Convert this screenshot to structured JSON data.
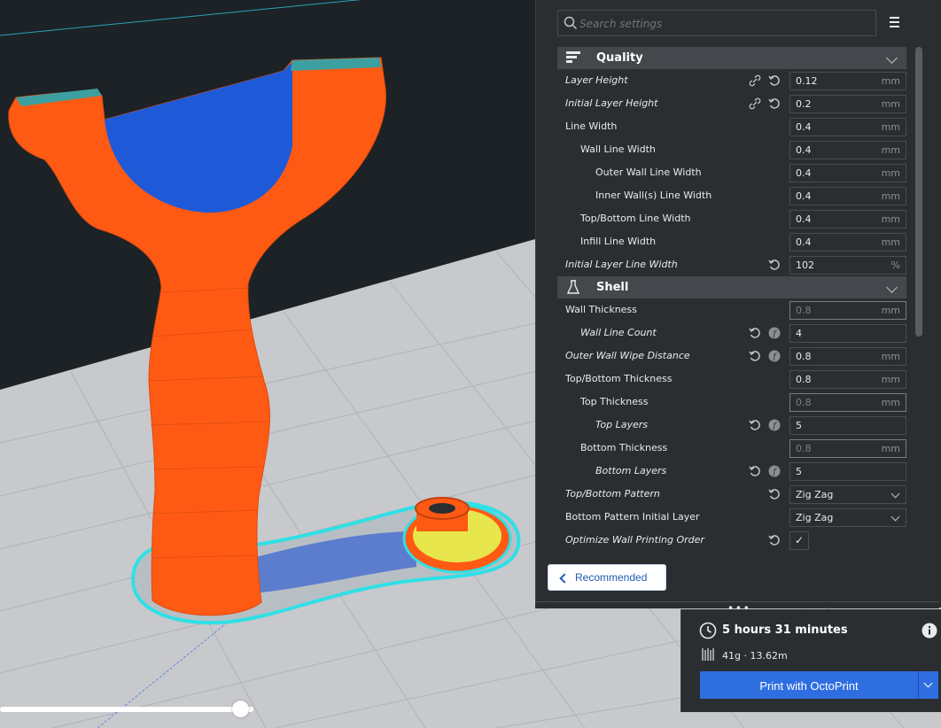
{
  "search": {
    "placeholder": "Search settings"
  },
  "categories": {
    "quality": "Quality",
    "shell": "Shell"
  },
  "quality_settings": [
    {
      "label": "Layer Height",
      "value": "0.12",
      "unit": "mm"
    },
    {
      "label": "Initial Layer Height",
      "value": "0.2",
      "unit": "mm"
    },
    {
      "label": "Line Width",
      "value": "0.4",
      "unit": "mm"
    },
    {
      "label": "Wall Line Width",
      "value": "0.4",
      "unit": "mm"
    },
    {
      "label": "Outer Wall Line Width",
      "value": "0.4",
      "unit": "mm"
    },
    {
      "label": "Inner Wall(s) Line Width",
      "value": "0.4",
      "unit": "mm"
    },
    {
      "label": "Top/Bottom Line Width",
      "value": "0.4",
      "unit": "mm"
    },
    {
      "label": "Infill Line Width",
      "value": "0.4",
      "unit": "mm"
    },
    {
      "label": "Initial Layer Line Width",
      "value": "102",
      "unit": "%"
    }
  ],
  "shell_settings": [
    {
      "label": "Wall Thickness",
      "value": "0.8",
      "unit": "mm"
    },
    {
      "label": "Wall Line Count",
      "value": "4",
      "unit": ""
    },
    {
      "label": "Outer Wall Wipe Distance",
      "value": "0.8",
      "unit": "mm"
    },
    {
      "label": "Top/Bottom Thickness",
      "value": "0.8",
      "unit": "mm"
    },
    {
      "label": "Top Thickness",
      "value": "0.8",
      "unit": "mm"
    },
    {
      "label": "Top Layers",
      "value": "5",
      "unit": ""
    },
    {
      "label": "Bottom Thickness",
      "value": "0.8",
      "unit": "mm"
    },
    {
      "label": "Bottom Layers",
      "value": "5",
      "unit": ""
    },
    {
      "label": "Top/Bottom Pattern",
      "value": "Zig Zag",
      "unit": ""
    },
    {
      "label": "Bottom Pattern Initial Layer",
      "value": "Zig Zag",
      "unit": ""
    },
    {
      "label": "Optimize Wall Printing Order",
      "value": "✓",
      "unit": ""
    }
  ],
  "recommended_label": "Recommended",
  "print": {
    "time": "5 hours 31 minutes",
    "material": "41g · 13.62m",
    "button_label": "Print with OctoPrint"
  },
  "layer_slider": {
    "fraction": 0.95
  },
  "colors": {
    "accent": "#2f6ee0",
    "model": "#ff5a14",
    "infill": "#1e5ad7",
    "skirt": "#2fe0e6"
  }
}
